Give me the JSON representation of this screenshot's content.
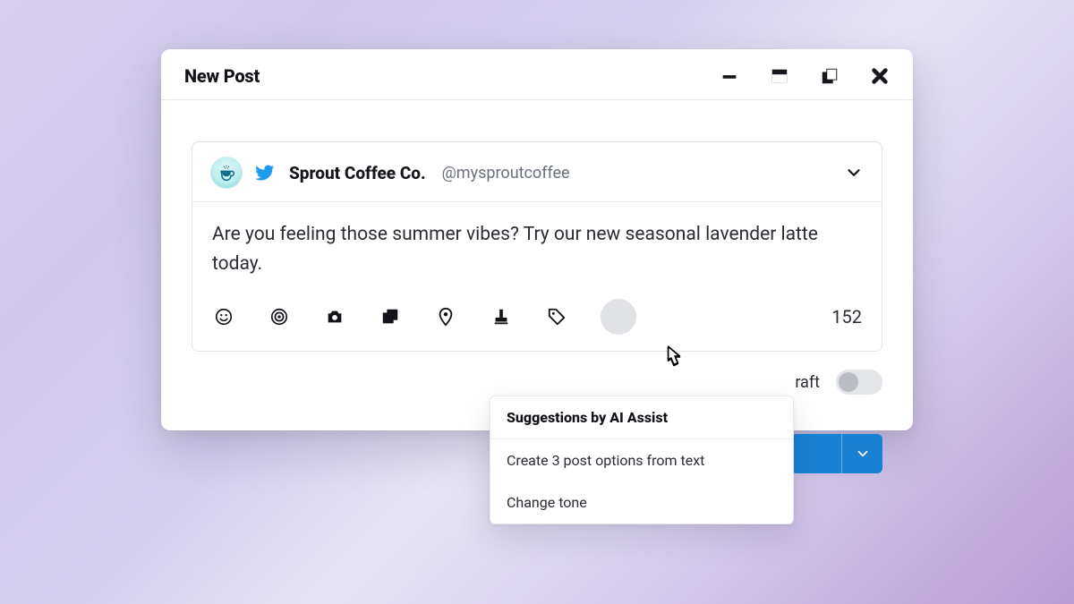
{
  "window": {
    "title": "New Post"
  },
  "account": {
    "display_name": "Sprout Coffee Co.",
    "handle": "@mysproutcoffee"
  },
  "post": {
    "text": "Are you feeling those summer vibes? Try our new seasonal lavender latte today.",
    "char_counter": "152"
  },
  "toolbar_icons": {
    "emoji": "emoji-icon",
    "target": "target-icon",
    "camera": "camera-icon",
    "gallery": "gallery-icon",
    "location": "location-pin-icon",
    "stamp": "stamp-icon",
    "tag": "tag-icon",
    "ai": "ai-assist-icon"
  },
  "ai_popover": {
    "title": "Suggestions by AI Assist",
    "items": [
      "Create 3 post options from text",
      "Change tone"
    ]
  },
  "footer": {
    "draft_label": "raft"
  },
  "colors": {
    "primary": "#1881d4",
    "twitter": "#1d9bf0"
  }
}
